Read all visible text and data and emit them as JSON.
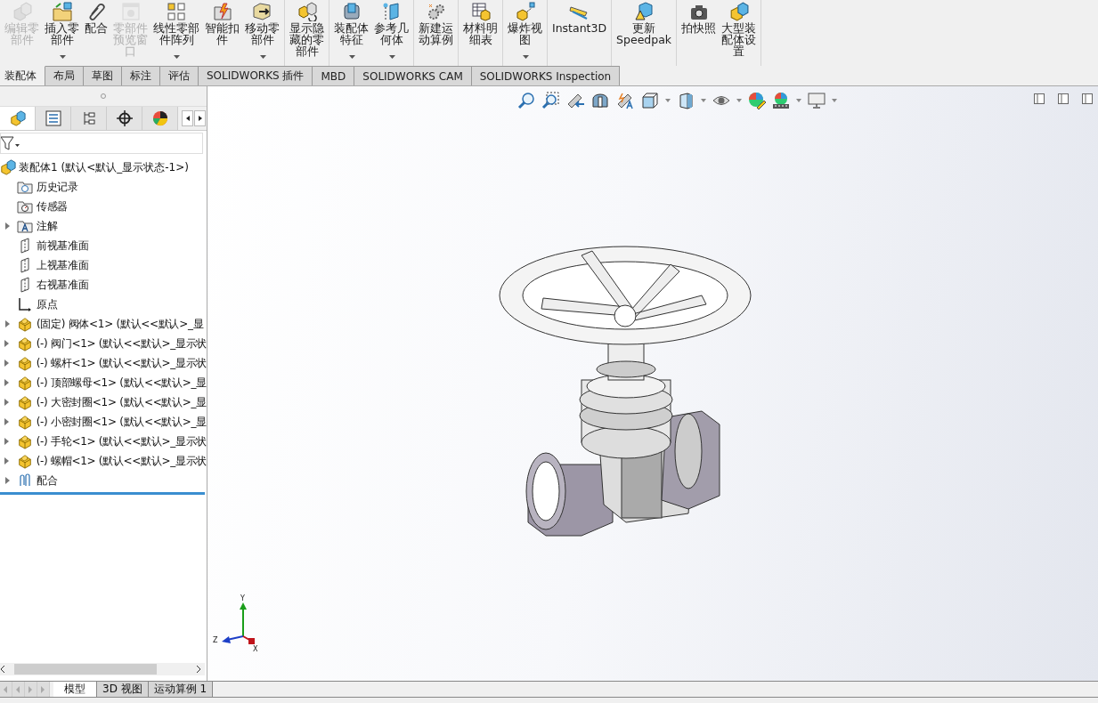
{
  "ribbon": {
    "groups": [
      {
        "items": [
          {
            "lines": [
              "编辑零",
              "部件"
            ],
            "disabled": true,
            "dropdown": false
          },
          {
            "lines": [
              "插入零",
              "部件"
            ],
            "disabled": false,
            "dropdown": true
          },
          {
            "lines": [
              "配合"
            ],
            "disabled": false,
            "dropdown": false
          },
          {
            "lines": [
              "零部件",
              "预览窗",
              "口"
            ],
            "disabled": true,
            "dropdown": false
          },
          {
            "lines": [
              "线性零部",
              "件阵列"
            ],
            "disabled": false,
            "dropdown": true
          },
          {
            "lines": [
              "智能扣",
              "件"
            ],
            "disabled": false,
            "dropdown": false
          },
          {
            "lines": [
              "移动零",
              "部件"
            ],
            "disabled": false,
            "dropdown": true
          }
        ]
      },
      {
        "items": [
          {
            "lines": [
              "显示隐",
              "藏的零",
              "部件"
            ],
            "disabled": false,
            "dropdown": false
          }
        ]
      },
      {
        "items": [
          {
            "lines": [
              "装配体",
              "特征"
            ],
            "disabled": false,
            "dropdown": true
          },
          {
            "lines": [
              "参考几",
              "何体"
            ],
            "disabled": false,
            "dropdown": true
          }
        ]
      },
      {
        "items": [
          {
            "lines": [
              "新建运",
              "动算例"
            ],
            "disabled": false,
            "dropdown": false
          }
        ]
      },
      {
        "items": [
          {
            "lines": [
              "材料明",
              "细表"
            ],
            "disabled": false,
            "dropdown": false
          }
        ]
      },
      {
        "items": [
          {
            "lines": [
              "爆炸视",
              "图"
            ],
            "disabled": false,
            "dropdown": true
          }
        ]
      },
      {
        "items": [
          {
            "lines": [
              "Instant3D"
            ],
            "disabled": false,
            "dropdown": false
          }
        ]
      },
      {
        "items": [
          {
            "lines": [
              "更新",
              "Speedpak"
            ],
            "disabled": false,
            "dropdown": false
          }
        ]
      },
      {
        "items": [
          {
            "lines": [
              "拍快照"
            ],
            "disabled": false,
            "dropdown": false
          },
          {
            "lines": [
              "大型装",
              "配体设",
              "置"
            ],
            "disabled": false,
            "dropdown": false
          }
        ]
      }
    ]
  },
  "command_tabs": [
    {
      "label": "装配体",
      "selected": true
    },
    {
      "label": "布局",
      "selected": false
    },
    {
      "label": "草图",
      "selected": false
    },
    {
      "label": "标注",
      "selected": false
    },
    {
      "label": "评估",
      "selected": false
    },
    {
      "label": "SOLIDWORKS 插件",
      "selected": false
    },
    {
      "label": "MBD",
      "selected": false
    },
    {
      "label": "SOLIDWORKS CAM",
      "selected": false
    },
    {
      "label": "SOLIDWORKS Inspection",
      "selected": false
    }
  ],
  "panel_tabs": [
    {
      "selected": true
    },
    {
      "selected": false
    },
    {
      "selected": false
    },
    {
      "selected": false
    },
    {
      "selected": false
    }
  ],
  "feature_tree": {
    "label": "装配体1  (默认<默认_显示状态-1>)",
    "children": [
      {
        "label": "历史记录",
        "kind": "history",
        "collapsed": false
      },
      {
        "label": "传感器",
        "kind": "sensors",
        "collapsed": false
      },
      {
        "label": "注解",
        "kind": "annotations",
        "collapsed": true
      },
      {
        "label": "前视基准面",
        "kind": "plane",
        "collapsed": false
      },
      {
        "label": "上视基准面",
        "kind": "plane",
        "collapsed": false
      },
      {
        "label": "右视基准面",
        "kind": "plane",
        "collapsed": false
      },
      {
        "label": "原点",
        "kind": "origin",
        "collapsed": false
      },
      {
        "label": "(固定) 阀体<1> (默认<<默认>_显",
        "kind": "component",
        "collapsed": true
      },
      {
        "label": "(-) 阀门<1> (默认<<默认>_显示状",
        "kind": "component",
        "collapsed": true
      },
      {
        "label": "(-) 螺杆<1> (默认<<默认>_显示状",
        "kind": "component",
        "collapsed": true
      },
      {
        "label": "(-) 顶部螺母<1> (默认<<默认>_显",
        "kind": "component",
        "collapsed": true
      },
      {
        "label": "(-) 大密封圈<1> (默认<<默认>_显",
        "kind": "component",
        "collapsed": true
      },
      {
        "label": "(-) 小密封圈<1> (默认<<默认>_显",
        "kind": "component",
        "collapsed": true
      },
      {
        "label": "(-) 手轮<1> (默认<<默认>_显示状",
        "kind": "component",
        "collapsed": true
      },
      {
        "label": "(-) 螺帽<1> (默认<<默认>_显示状",
        "kind": "component",
        "collapsed": true
      },
      {
        "label": "配合",
        "kind": "mates",
        "collapsed": true
      }
    ]
  },
  "triad": {
    "x_label": "X",
    "y_label": "Y",
    "z_label": "Z"
  },
  "bottom_tabs": [
    {
      "label": "模型",
      "selected": true
    },
    {
      "label": "3D 视图",
      "selected": false
    },
    {
      "label": "运动算例 1",
      "selected": false
    }
  ]
}
